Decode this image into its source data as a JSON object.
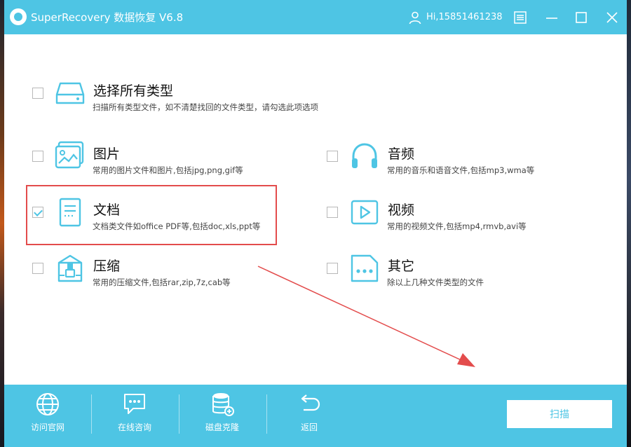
{
  "app": {
    "title": "SuperRecovery 数据恢复 V6.8",
    "user": "Hi,15851461238"
  },
  "options": [
    {
      "id": "all",
      "title": "选择所有类型",
      "desc": "扫描所有类型文件，如不清楚找回的文件类型，请勾选此项选项",
      "checked": false,
      "icon": "hard-drive-icon"
    },
    {
      "id": "image",
      "title": "图片",
      "desc": "常用的图片文件和图片,包括jpg,png,gif等",
      "checked": false,
      "icon": "image-icon"
    },
    {
      "id": "audio",
      "title": "音频",
      "desc": "常用的音乐和语音文件,包括mp3,wma等",
      "checked": false,
      "icon": "headphones-icon"
    },
    {
      "id": "document",
      "title": "文档",
      "desc": "文档类文件如office PDF等,包括doc,xls,ppt等",
      "checked": true,
      "icon": "document-icon"
    },
    {
      "id": "video",
      "title": "视频",
      "desc": "常用的视频文件,包括mp4,rmvb,avi等",
      "checked": false,
      "icon": "play-icon"
    },
    {
      "id": "archive",
      "title": "压缩",
      "desc": "常用的压缩文件,包括rar,zip,7z,cab等",
      "checked": false,
      "icon": "archive-icon"
    },
    {
      "id": "other",
      "title": "其它",
      "desc": "除以上几种文件类型的文件",
      "checked": false,
      "icon": "more-icon"
    }
  ],
  "footer": {
    "items": [
      {
        "label": "访问官网",
        "icon": "globe-icon"
      },
      {
        "label": "在线咨询",
        "icon": "chat-icon"
      },
      {
        "label": "磁盘克隆",
        "icon": "database-icon"
      },
      {
        "label": "返回",
        "icon": "back-icon"
      }
    ],
    "scan_label": "扫描"
  },
  "colors": {
    "accent": "#4ec5e4",
    "highlight": "#e34c4c"
  }
}
